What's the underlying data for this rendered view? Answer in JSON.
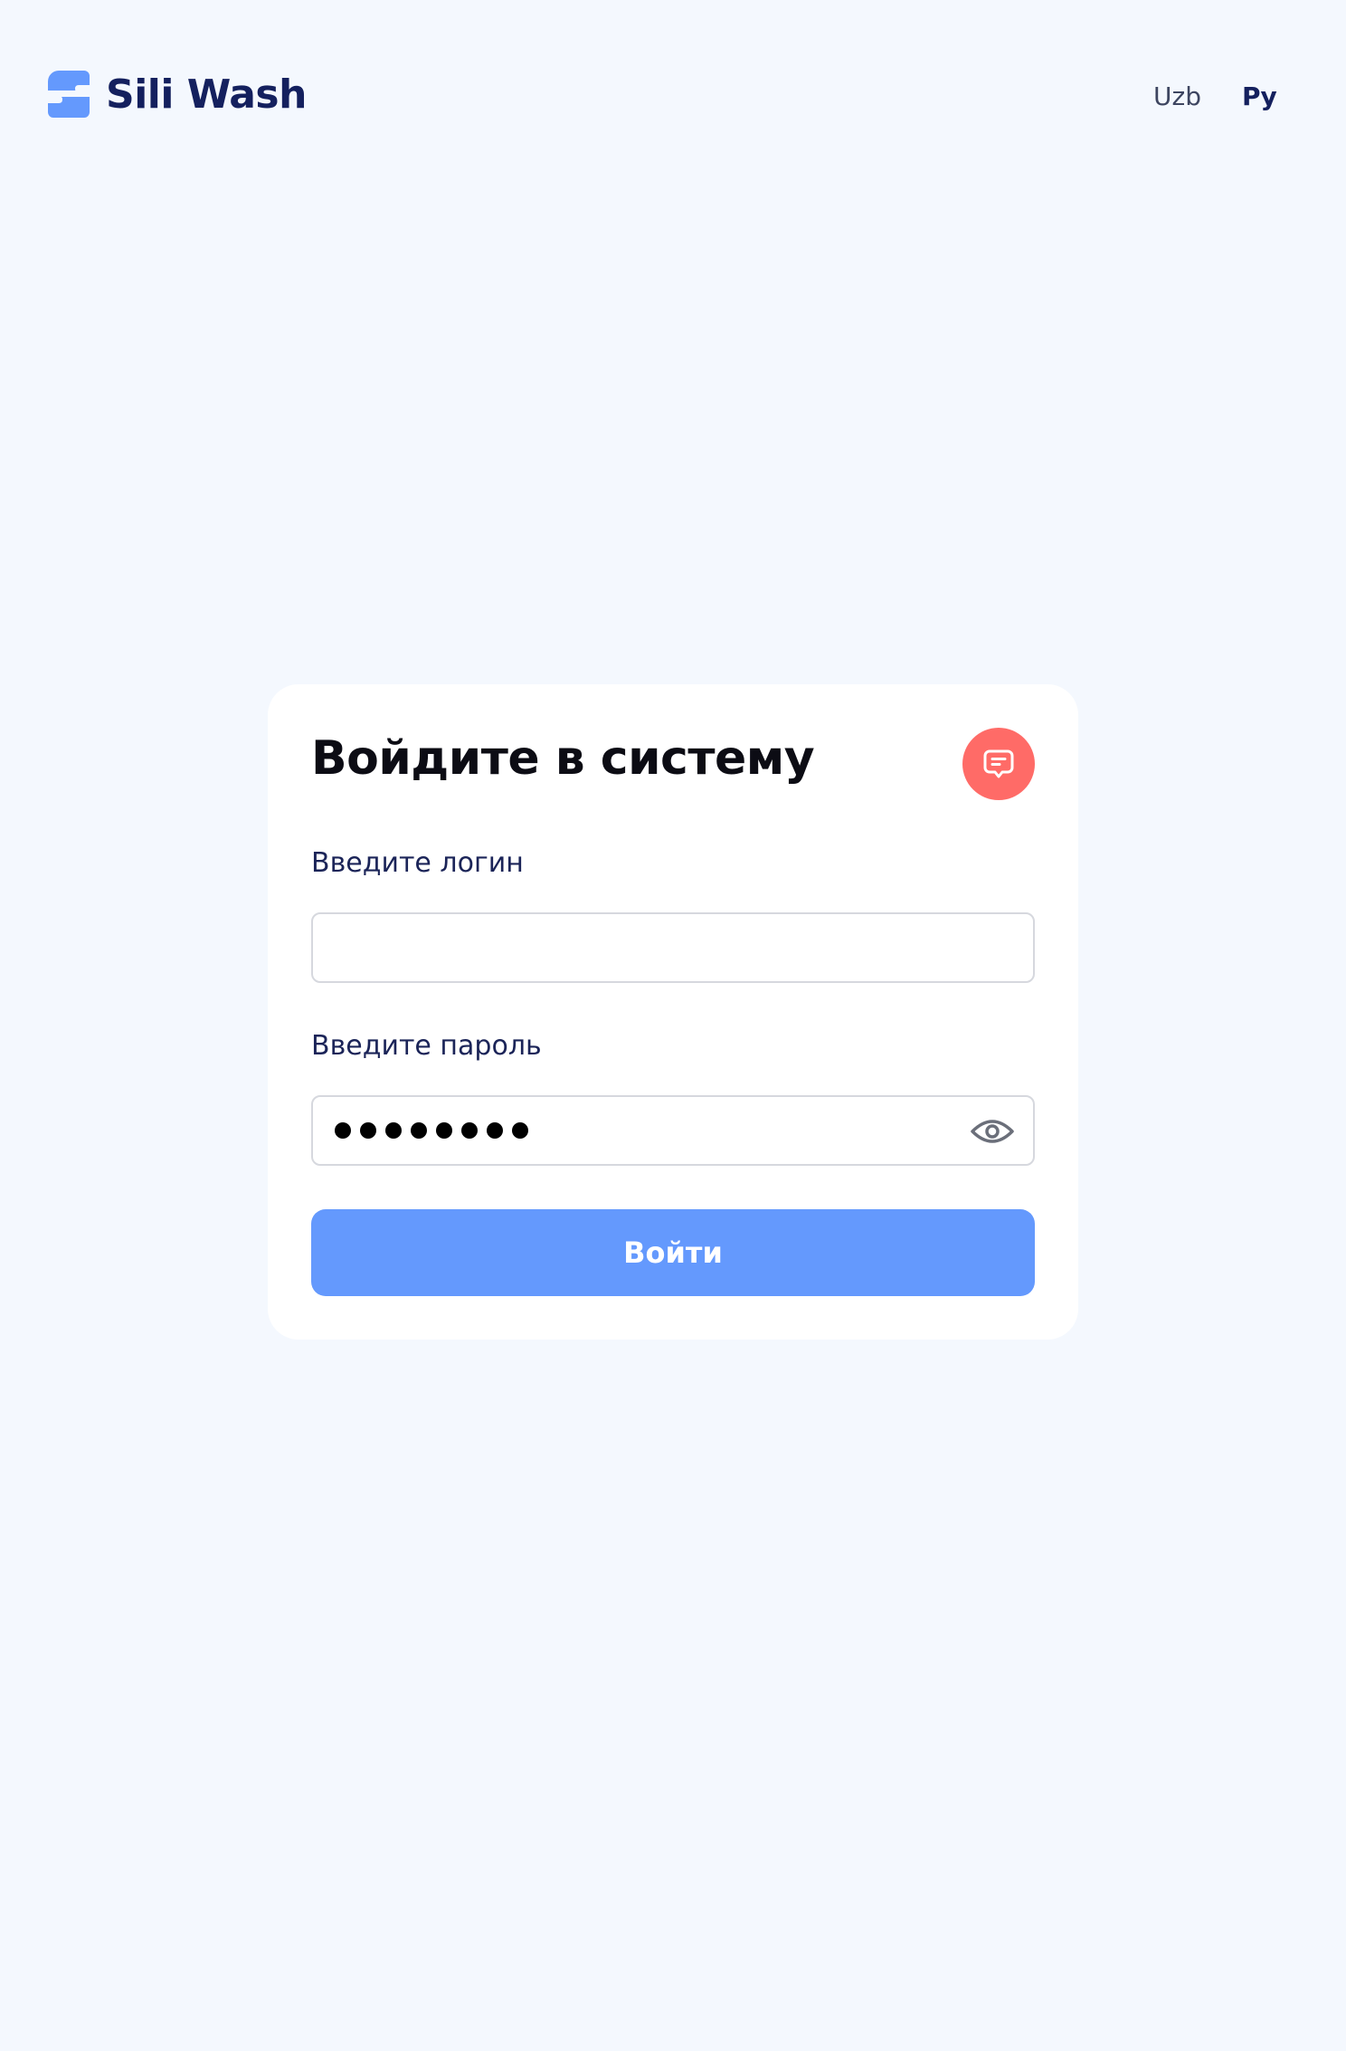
{
  "header": {
    "logo_text": "Sili Wash",
    "languages": [
      {
        "label": "Uzb",
        "active": false
      },
      {
        "label": "Ру",
        "active": true
      }
    ]
  },
  "login_card": {
    "title": "Войдите в систему",
    "login_label": "Введите логин",
    "login_value": "",
    "password_label": "Введите пароль",
    "password_masked_length": 8,
    "submit_label": "Войти",
    "support_icon": "chat-bubble-icon",
    "toggle_icon": "eye-icon"
  },
  "colors": {
    "background": "#f4f8fe",
    "brand_dark": "#14205e",
    "accent": "#6499fd",
    "support": "#ff6b67"
  }
}
